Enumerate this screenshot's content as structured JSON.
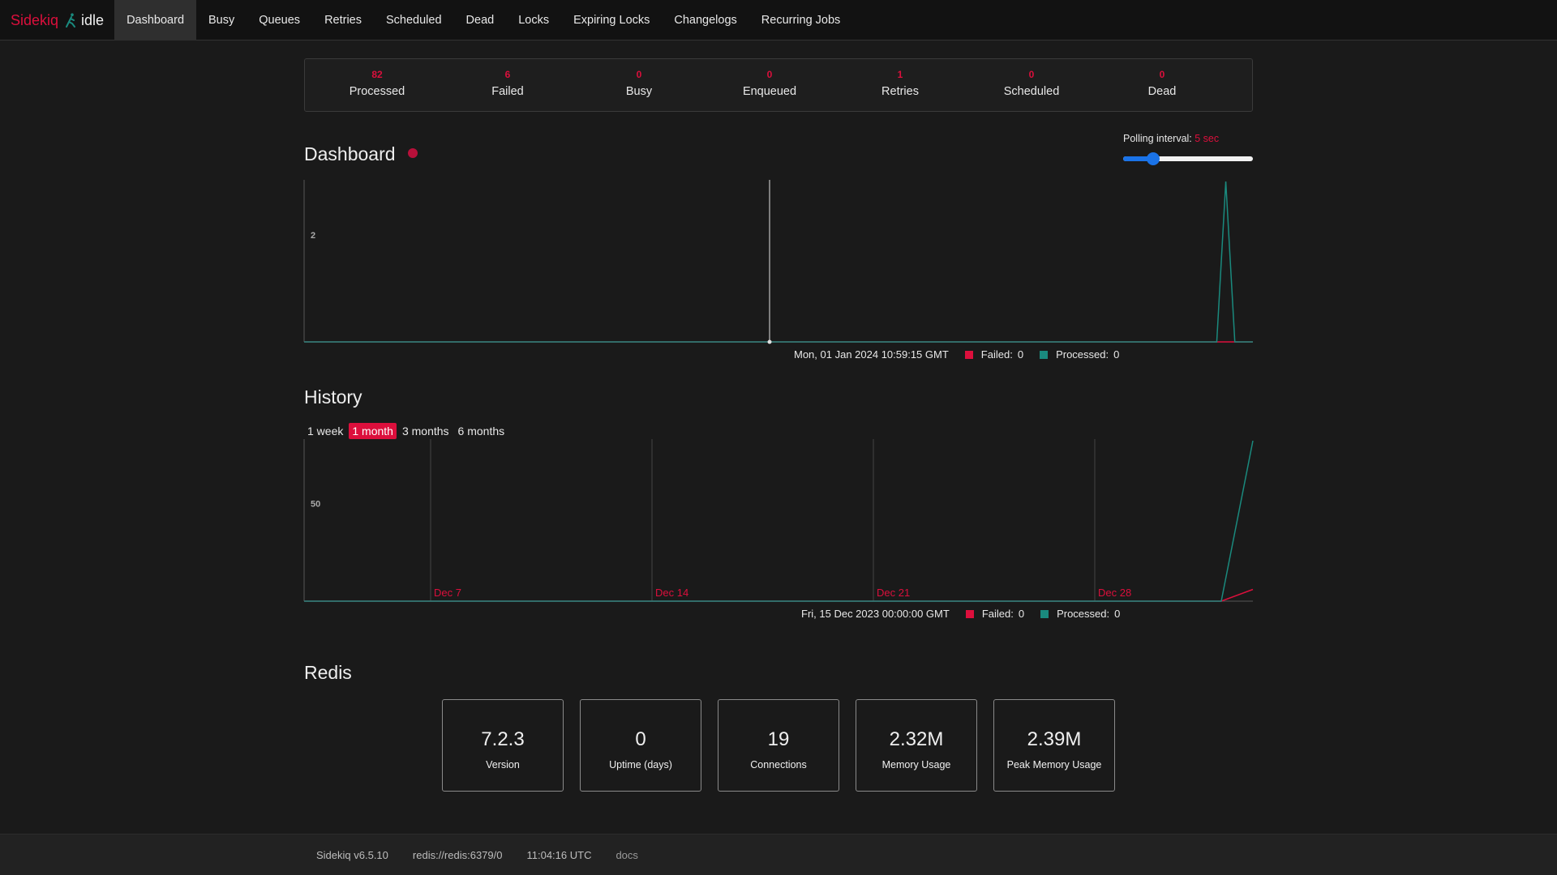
{
  "brand": {
    "name": "Sidekiq",
    "logo_icon": "runner-icon",
    "status": "idle"
  },
  "nav": [
    "Dashboard",
    "Busy",
    "Queues",
    "Retries",
    "Scheduled",
    "Dead",
    "Locks",
    "Expiring Locks",
    "Changelogs",
    "Recurring Jobs"
  ],
  "summary": [
    {
      "count": "82",
      "label": "Processed"
    },
    {
      "count": "6",
      "label": "Failed"
    },
    {
      "count": "0",
      "label": "Busy"
    },
    {
      "count": "0",
      "label": "Enqueued"
    },
    {
      "count": "1",
      "label": "Retries"
    },
    {
      "count": "0",
      "label": "Scheduled"
    },
    {
      "count": "0",
      "label": "Dead"
    }
  ],
  "dashboard": {
    "title": "Dashboard",
    "polling_label": "Polling interval:",
    "polling_value": "5 sec",
    "polling_level": 0.2
  },
  "history": {
    "title": "History",
    "ranges": [
      "1 week",
      "1 month",
      "3 months",
      "6 months"
    ],
    "active_range": "1 month"
  },
  "legend": {
    "failed_label": "Failed:",
    "processed_label": "Processed:"
  },
  "colors": {
    "accent": "#dc0f3c",
    "failed": "#dc0f3c",
    "processed": "#1a8a7e",
    "slider": "#1a73e8"
  },
  "chart_data": [
    {
      "type": "line",
      "ytick": "2",
      "series": [
        {
          "name": "Failed",
          "values": [
            0,
            0,
            0,
            0,
            0,
            0,
            0,
            0,
            0,
            0,
            0,
            0,
            0,
            0,
            0,
            0,
            0,
            0,
            0,
            0,
            0,
            0,
            0,
            0,
            0,
            0,
            0,
            0,
            0,
            0,
            0,
            0,
            0,
            0,
            0,
            0,
            0,
            0,
            0,
            0,
            0,
            0,
            0,
            0,
            0,
            0,
            0,
            0,
            0,
            0,
            0,
            0,
            0,
            0,
            0,
            0,
            0,
            0,
            0,
            0,
            0,
            0,
            0,
            0,
            0,
            0,
            0,
            0,
            0,
            0,
            0,
            0,
            0,
            0,
            0,
            0,
            0,
            0,
            0,
            0,
            0,
            0,
            0,
            0,
            0,
            0,
            0,
            0,
            0,
            0,
            0,
            0,
            0,
            0,
            0,
            0,
            0,
            0,
            0,
            0,
            0,
            0,
            0,
            0,
            0,
            0
          ]
        },
        {
          "name": "Processed",
          "values": [
            0,
            0,
            0,
            0,
            0,
            0,
            0,
            0,
            0,
            0,
            0,
            0,
            0,
            0,
            0,
            0,
            0,
            0,
            0,
            0,
            0,
            0,
            0,
            0,
            0,
            0,
            0,
            0,
            0,
            0,
            0,
            0,
            0,
            0,
            0,
            0,
            0,
            0,
            0,
            0,
            0,
            0,
            0,
            0,
            0,
            0,
            0,
            0,
            0,
            0,
            0,
            0,
            0,
            0,
            0,
            0,
            0,
            0,
            0,
            0,
            0,
            0,
            0,
            0,
            0,
            0,
            0,
            0,
            0,
            0,
            0,
            0,
            0,
            0,
            0,
            0,
            0,
            0,
            0,
            0,
            0,
            0,
            0,
            0,
            0,
            0,
            0,
            0,
            0,
            0,
            0,
            0,
            0,
            0,
            0,
            0,
            0,
            0,
            0,
            0,
            0,
            0,
            3,
            0,
            0,
            0
          ]
        }
      ],
      "ylim": [
        0,
        3
      ],
      "hover": {
        "time": "Mon, 01 Jan 2024 10:59:15 GMT",
        "failed": "0",
        "processed": "0"
      }
    },
    {
      "type": "line",
      "ytick": "50",
      "x_labels": [
        "Dec 7",
        "Dec 14",
        "Dec 21",
        "Dec 28"
      ],
      "x_label_days": [
        4,
        11,
        18,
        25
      ],
      "series": [
        {
          "name": "Failed",
          "values": [
            0,
            0,
            0,
            0,
            0,
            0,
            0,
            0,
            0,
            0,
            0,
            0,
            0,
            0,
            0,
            0,
            0,
            0,
            0,
            0,
            0,
            0,
            0,
            0,
            0,
            0,
            0,
            0,
            0,
            0,
            6
          ]
        },
        {
          "name": "Processed",
          "values": [
            0,
            0,
            0,
            0,
            0,
            0,
            0,
            0,
            0,
            0,
            0,
            0,
            0,
            0,
            0,
            0,
            0,
            0,
            0,
            0,
            0,
            0,
            0,
            0,
            0,
            0,
            0,
            0,
            0,
            0,
            82
          ]
        }
      ],
      "ylim": [
        0,
        82
      ],
      "hover": {
        "time": "Fri, 15 Dec 2023 00:00:00 GMT",
        "failed": "0",
        "processed": "0"
      }
    }
  ],
  "redis": {
    "title": "Redis",
    "stats": [
      {
        "value": "7.2.3",
        "label": "Version"
      },
      {
        "value": "0",
        "label": "Uptime (days)"
      },
      {
        "value": "19",
        "label": "Connections"
      },
      {
        "value": "2.32M",
        "label": "Memory Usage"
      },
      {
        "value": "2.39M",
        "label": "Peak Memory Usage"
      }
    ]
  },
  "footer": {
    "version": "Sidekiq v6.5.10",
    "redis_url": "redis://redis:6379/0",
    "time": "11:04:16 UTC",
    "docs": "docs"
  }
}
